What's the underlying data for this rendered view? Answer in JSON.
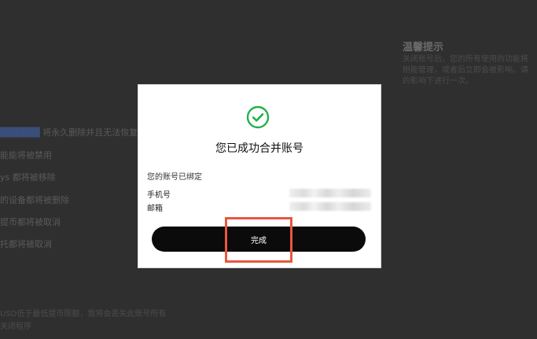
{
  "background": {
    "side_panel_title": "温馨提示",
    "side_panel_lines": [
      "关闭账号后，您的所有使用的功能将",
      "刚能管理，或者后立即会被影响。请",
      "的影响下进行一次。"
    ],
    "left_lines": [
      {
        "prefix": "",
        "link": "██████",
        "text": " 将永久删除并且无法恢复"
      },
      {
        "prefix": "",
        "link": "",
        "text": "能能将被禁用"
      },
      {
        "prefix": "",
        "link": "",
        "text": "ys 都将被移除"
      },
      {
        "prefix": "",
        "link": "",
        "text": "的设备都将被删除"
      },
      {
        "prefix": "",
        "link": "",
        "text": "提币都将被取消"
      },
      {
        "prefix": "",
        "link": "",
        "text": "托都将被取消"
      }
    ],
    "bottom_lines": [
      "USD低于最低提币限额，我将会丢失此账号所有",
      "关闭程序"
    ]
  },
  "modal": {
    "title": "您已成功合并账号",
    "bound_caption": "您的账号已绑定",
    "rows": [
      {
        "label": "手机号"
      },
      {
        "label": "邮箱"
      }
    ],
    "done_label": "完成"
  },
  "colors": {
    "accent_green": "#22b14c",
    "highlight_red": "#e8573f",
    "button_black": "#0b0b0b"
  },
  "icons": {
    "success": "check-circle-icon"
  }
}
